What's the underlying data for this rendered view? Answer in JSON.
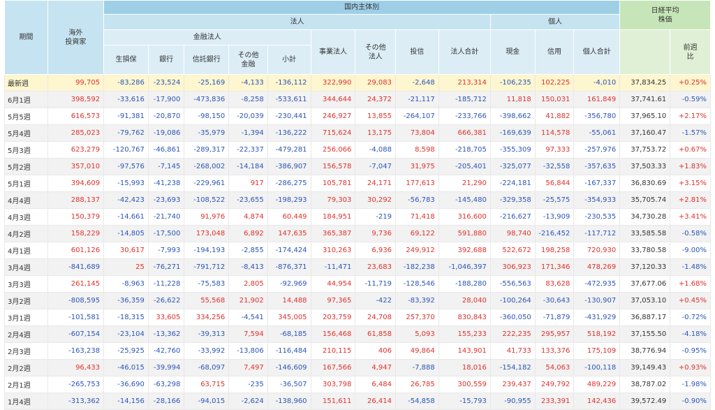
{
  "header": {
    "period": "期間",
    "overseas": "海外\n投資家",
    "domestic": "国内主体別",
    "corporate": "法人",
    "individual": "個人",
    "financial": "金融法人",
    "nikkei": "日経平均\n株価",
    "weekly_change": "前週\n比",
    "cols": {
      "insurance": "生損保",
      "bank": "銀行",
      "trust": "信託銀行",
      "other_fin": "その他\n金融",
      "subtotal": "小計",
      "business": "事業法人",
      "other_corp": "その他\n法人",
      "invest_trust": "投信",
      "corp_total": "法人合計",
      "cash": "現金",
      "margin": "信用",
      "indiv_total": "個人合計"
    }
  },
  "rows": [
    {
      "period": "最新週",
      "latest": true,
      "v": [
        "99,705",
        "-83,286",
        "-23,524",
        "-25,169",
        "-4,133",
        "-136,112",
        "322,990",
        "29,083",
        "-2,648",
        "213,314",
        "-106,235",
        "102,225",
        "-4,010",
        "37,834.25",
        "+0.25%"
      ]
    },
    {
      "period": "6月1週",
      "v": [
        "398,592",
        "-33,616",
        "-17,900",
        "-473,836",
        "-8,258",
        "-533,611",
        "344,644",
        "24,372",
        "-21,117",
        "-185,712",
        "11,818",
        "150,031",
        "161,849",
        "37,741.61",
        "-0.59%"
      ]
    },
    {
      "period": "5月5週",
      "v": [
        "616,573",
        "-91,381",
        "-20,870",
        "-98,150",
        "-20,039",
        "-230,441",
        "246,927",
        "13,855",
        "-264,107",
        "-233,766",
        "-398,662",
        "41,882",
        "-356,780",
        "37,965.10",
        "+2.17%"
      ]
    },
    {
      "period": "5月4週",
      "v": [
        "285,023",
        "-79,762",
        "-19,086",
        "-35,979",
        "-1,394",
        "-136,222",
        "715,624",
        "13,175",
        "73,804",
        "666,381",
        "-169,639",
        "114,578",
        "-55,061",
        "37,160.47",
        "-1.57%"
      ]
    },
    {
      "period": "5月3週",
      "v": [
        "623,279",
        "-120,767",
        "-46,861",
        "-289,317",
        "-22,337",
        "-479,281",
        "256,066",
        "-4,088",
        "8,598",
        "-218,705",
        "-355,309",
        "97,333",
        "-257,976",
        "37,753.72",
        "+0.67%"
      ]
    },
    {
      "period": "5月2週",
      "v": [
        "357,010",
        "-97,576",
        "-7,145",
        "-268,002",
        "-14,184",
        "-386,907",
        "156,578",
        "-7,047",
        "31,975",
        "-205,401",
        "-325,077",
        "-32,558",
        "-357,635",
        "37,503.33",
        "+1.83%"
      ]
    },
    {
      "period": "5月1週",
      "v": [
        "394,609",
        "-15,993",
        "-41,238",
        "-229,961",
        "917",
        "-286,275",
        "105,781",
        "24,171",
        "177,613",
        "21,290",
        "-224,181",
        "56,844",
        "-167,337",
        "36,830.69",
        "+3.15%"
      ]
    },
    {
      "period": "4月4週",
      "v": [
        "288,137",
        "-42,423",
        "-23,693",
        "-108,522",
        "-23,655",
        "-198,293",
        "79,303",
        "30,292",
        "-56,783",
        "-145,480",
        "-329,358",
        "-25,575",
        "-354,933",
        "35,705.74",
        "+2.81%"
      ]
    },
    {
      "period": "4月3週",
      "v": [
        "150,379",
        "-14,661",
        "-21,740",
        "91,976",
        "4,874",
        "60,449",
        "184,951",
        "-219",
        "71,418",
        "316,600",
        "-216,627",
        "-13,909",
        "-230,535",
        "34,730.28",
        "+3.41%"
      ]
    },
    {
      "period": "4月2週",
      "v": [
        "158,229",
        "-14,805",
        "-17,500",
        "173,048",
        "6,892",
        "147,635",
        "365,387",
        "9,736",
        "69,122",
        "591,880",
        "98,740",
        "-216,452",
        "-117,712",
        "33,585.58",
        "-0.58%"
      ]
    },
    {
      "period": "4月1週",
      "v": [
        "601,126",
        "30,617",
        "-7,993",
        "-194,193",
        "-2,855",
        "-174,424",
        "310,263",
        "6,936",
        "249,912",
        "392,688",
        "522,672",
        "198,258",
        "720,930",
        "33,780.58",
        "-9.00%"
      ]
    },
    {
      "period": "3月4週",
      "v": [
        "-841,689",
        "25",
        "-76,271",
        "-791,712",
        "-8,413",
        "-876,371",
        "-11,471",
        "23,683",
        "-182,238",
        "-1,046,397",
        "306,923",
        "171,346",
        "478,269",
        "37,120.33",
        "-1.48%"
      ]
    },
    {
      "period": "3月3週",
      "v": [
        "261,145",
        "-8,963",
        "-11,228",
        "-75,583",
        "2,805",
        "-92,969",
        "44,954",
        "-11,719",
        "-128,546",
        "-188,280",
        "-556,563",
        "83,628",
        "-472,935",
        "37,677.06",
        "+1.68%"
      ]
    },
    {
      "period": "3月2週",
      "v": [
        "-808,595",
        "-36,359",
        "-26,622",
        "55,568",
        "21,902",
        "14,488",
        "97,365",
        "-422",
        "-83,392",
        "28,040",
        "-100,264",
        "-30,643",
        "-130,907",
        "37,053.10",
        "+0.45%"
      ]
    },
    {
      "period": "3月1週",
      "v": [
        "-101,581",
        "-18,315",
        "33,605",
        "334,256",
        "-4,541",
        "345,005",
        "203,759",
        "24,708",
        "257,370",
        "830,843",
        "-360,050",
        "-71,879",
        "-431,929",
        "36,887.17",
        "-0.72%"
      ]
    },
    {
      "period": "2月4週",
      "v": [
        "-607,154",
        "-23,104",
        "-13,362",
        "-39,313",
        "7,594",
        "-68,185",
        "156,468",
        "61,858",
        "5,093",
        "155,233",
        "222,235",
        "295,957",
        "518,192",
        "37,155.50",
        "-4.18%"
      ]
    },
    {
      "period": "2月3週",
      "v": [
        "-163,238",
        "-25,925",
        "-42,760",
        "-33,992",
        "-13,806",
        "-116,484",
        "210,115",
        "406",
        "49,864",
        "143,901",
        "41,733",
        "133,376",
        "175,109",
        "38,776.94",
        "-0.95%"
      ]
    },
    {
      "period": "2月2週",
      "v": [
        "96,433",
        "-46,015",
        "-39,994",
        "-68,097",
        "7,497",
        "-146,609",
        "167,566",
        "4,947",
        "-7,888",
        "18,016",
        "-154,182",
        "54,063",
        "-100,118",
        "39,149.43",
        "+0.93%"
      ]
    },
    {
      "period": "2月1週",
      "v": [
        "-265,753",
        "-36,690",
        "-63,298",
        "63,715",
        "-235",
        "-36,507",
        "303,798",
        "6,484",
        "26,785",
        "300,559",
        "239,437",
        "249,792",
        "489,229",
        "38,787.02",
        "-1.98%"
      ]
    },
    {
      "period": "1月4週",
      "v": [
        "-313,362",
        "-14,156",
        "-28,166",
        "-94,015",
        "-2,624",
        "-138,960",
        "151,611",
        "26,414",
        "-54,858",
        "-15,793",
        "-90,955",
        "233,391",
        "142,436",
        "39,572.49",
        "-0.90%"
      ]
    }
  ]
}
